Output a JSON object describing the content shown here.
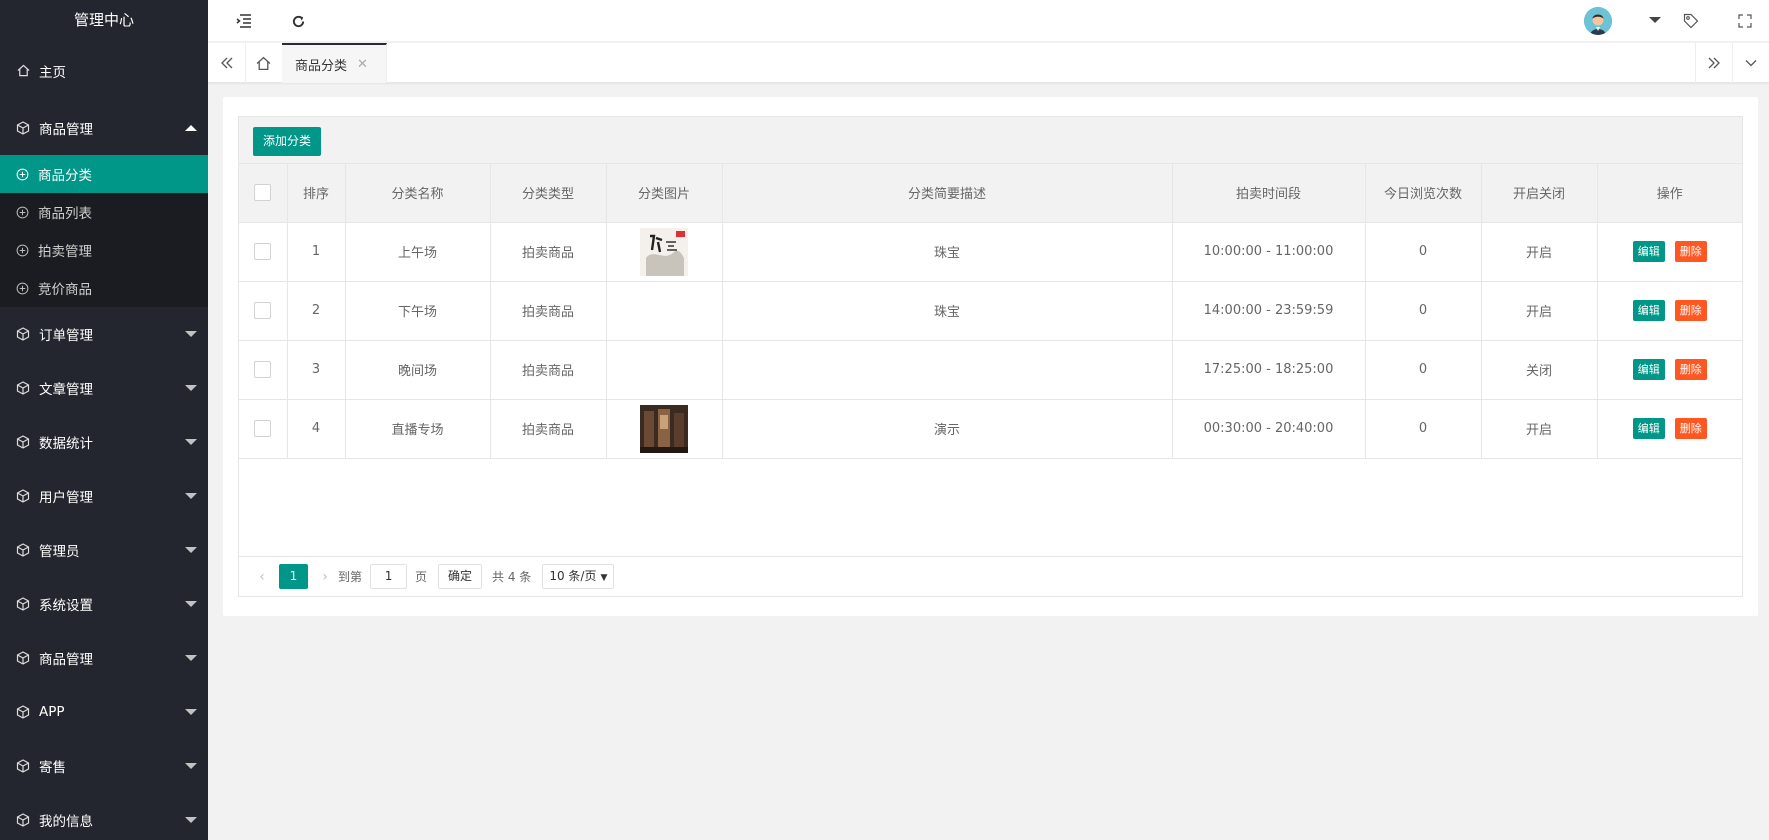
{
  "app": {
    "title": "管理中心"
  },
  "sidebar": {
    "home": "主页",
    "group_goods": "商品管理",
    "sub_items": [
      {
        "label": "商品分类",
        "active": true
      },
      {
        "label": "商品列表"
      },
      {
        "label": "拍卖管理"
      },
      {
        "label": "竞价商品"
      }
    ],
    "groups": [
      "订单管理",
      "文章管理",
      "数据统计",
      "用户管理",
      "管理员",
      "系统设置",
      "商品管理",
      "APP",
      "寄售",
      "我的信息"
    ]
  },
  "tabs": {
    "active_label": "商品分类"
  },
  "toolbar": {
    "add_label": "添加分类"
  },
  "table": {
    "headers": [
      "排序",
      "分类名称",
      "分类类型",
      "分类图片",
      "分类简要描述",
      "拍卖时间段",
      "今日浏览次数",
      "开启关闭",
      "操作"
    ],
    "rows": [
      {
        "order": "1",
        "name": "上午场",
        "type": "拍卖商品",
        "image": "book-cover",
        "desc": "珠宝",
        "time": "10:00:00 - 11:00:00",
        "views": "0",
        "status": "开启"
      },
      {
        "order": "2",
        "name": "下午场",
        "type": "拍卖商品",
        "image": "",
        "desc": "珠宝",
        "time": "14:00:00 - 23:59:59",
        "views": "0",
        "status": "开启"
      },
      {
        "order": "3",
        "name": "晚间场",
        "type": "拍卖商品",
        "image": "",
        "desc": "",
        "time": "17:25:00 - 18:25:00",
        "views": "0",
        "status": "关闭"
      },
      {
        "order": "4",
        "name": "直播专场",
        "type": "拍卖商品",
        "image": "room-photo",
        "desc": "演示",
        "time": "00:30:00 - 20:40:00",
        "views": "0",
        "status": "开启"
      }
    ],
    "edit_label": "编辑",
    "delete_label": "删除"
  },
  "pager": {
    "current": "1",
    "goto_label": "到第",
    "page_input": "1",
    "page_unit": "页",
    "ok_label": "确定",
    "total": "共 4 条",
    "limit": "10 条/页"
  },
  "colors": {
    "accent": "#009688",
    "danger": "#ff5722",
    "sidebar": "#23262e"
  }
}
